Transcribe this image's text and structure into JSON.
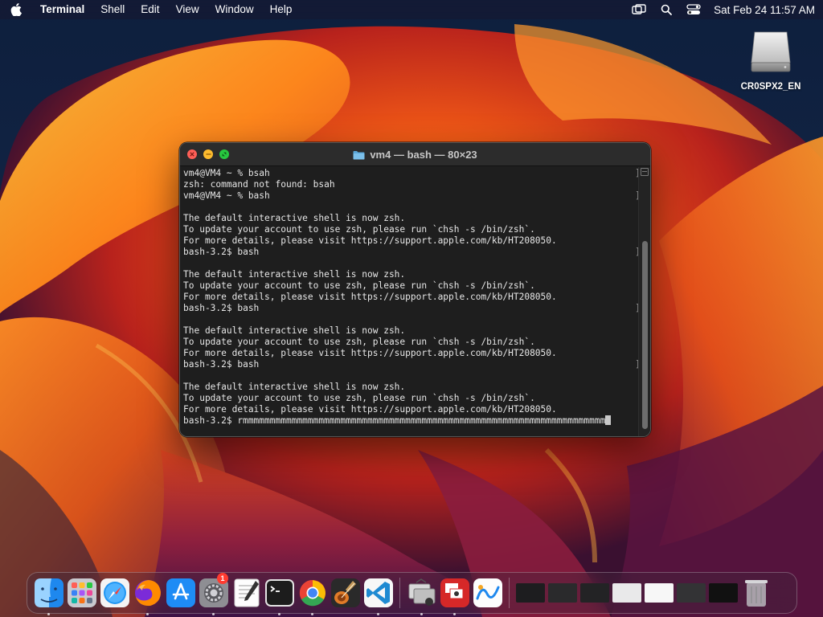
{
  "menubar": {
    "app_name": "Terminal",
    "menus": [
      "Shell",
      "Edit",
      "View",
      "Window",
      "Help"
    ],
    "clock": "Sat Feb 24  11:57 AM",
    "status_icons": [
      "screen-mirroring-icon",
      "search-icon",
      "control-center-icon"
    ]
  },
  "desktop": {
    "drive_label": "CR0SPX2_EN"
  },
  "terminal": {
    "title": "vm4 — bash — 80×23",
    "lines": [
      "vm4@VM4 ~ % bsah",
      "zsh: command not found: bsah",
      "vm4@VM4 ~ % bash",
      "",
      "The default interactive shell is now zsh.",
      "To update your account to use zsh, please run `chsh -s /bin/zsh`.",
      "For more details, please visit https://support.apple.com/kb/HT208050.",
      "bash-3.2$ bash",
      "",
      "The default interactive shell is now zsh.",
      "To update your account to use zsh, please run `chsh -s /bin/zsh`.",
      "For more details, please visit https://support.apple.com/kb/HT208050.",
      "bash-3.2$ bash",
      "",
      "The default interactive shell is now zsh.",
      "To update your account to use zsh, please run `chsh -s /bin/zsh`.",
      "For more details, please visit https://support.apple.com/kb/HT208050.",
      "bash-3.2$ bash",
      "",
      "The default interactive shell is now zsh.",
      "To update your account to use zsh, please run `chsh -s /bin/zsh`.",
      "For more details, please visit https://support.apple.com/kb/HT208050.",
      "bash-3.2$ rmmmmmmmmmmmmmmmmmmmmmmmmmmmmmmmmmmmmmmmmmmmmmmmmmmmmmmmmmmmmmmmmmmm"
    ],
    "bracketed_lines": [
      0,
      2,
      7,
      12,
      17
    ]
  },
  "dock": {
    "apps": [
      {
        "name": "finder-icon"
      },
      {
        "name": "launchpad-icon"
      },
      {
        "name": "safari-icon"
      },
      {
        "name": "firefox-icon"
      },
      {
        "name": "app-store-icon"
      },
      {
        "name": "system-settings-icon",
        "badge": "1"
      },
      {
        "name": "textedit-icon"
      },
      {
        "name": "terminal-icon"
      },
      {
        "name": "chrome-icon"
      },
      {
        "name": "garageband-icon"
      },
      {
        "name": "vscode-icon"
      },
      {
        "name": "migration-assistant-icon"
      },
      {
        "name": "photo-booth-icon"
      },
      {
        "name": "freeform-icon"
      }
    ],
    "colors": {
      "finder": "#2b8ef0",
      "vscode": "#1f8ad2",
      "chrome_red": "#ea4335",
      "chrome_yellow": "#fbbc05",
      "chrome_green": "#34a853",
      "chrome_blue": "#4285f4"
    }
  },
  "colors": {
    "terminal_bg": "#1e1e1e",
    "terminal_fg": "#e6e6e6",
    "titlebar_bg": "#2c2c2c",
    "close": "#fe5f57",
    "minimize": "#febc2e",
    "zoom": "#28c840",
    "wallpaper_orange": "#f36d1f",
    "wallpaper_navy": "#0d1a33"
  }
}
